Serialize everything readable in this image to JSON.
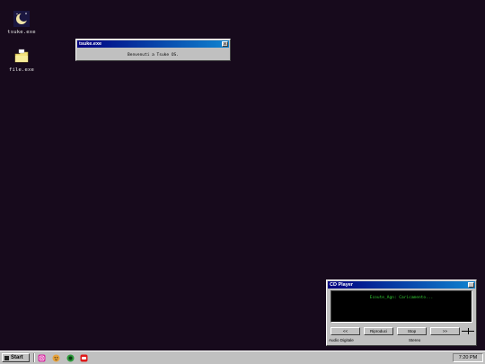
{
  "desktop": {
    "background_color": "#170a1c",
    "icons": [
      {
        "label": "tsuke.exe",
        "icon": "moon-icon"
      },
      {
        "label": "file.exe",
        "icon": "folder-icon"
      }
    ]
  },
  "dialog": {
    "title": "tsuke.exe",
    "close_symbol": "x",
    "message": "Benvenuti a Tsuke OS."
  },
  "cd_player": {
    "title": "CD Player",
    "minimize_symbol": "_",
    "display_text": "Ecoute_Agn: Caricamento...",
    "buttons": {
      "prev": "<<",
      "play": "Riproduci",
      "stop": "Stop",
      "next": ">>"
    },
    "status_left": "Audio Digitale",
    "status_right": "Stereo"
  },
  "taskbar": {
    "start_label": "Start",
    "quick_launch": [
      "instagram-icon",
      "face-icon",
      "green-app-icon",
      "red-app-icon"
    ],
    "clock": "7:20 PM"
  }
}
